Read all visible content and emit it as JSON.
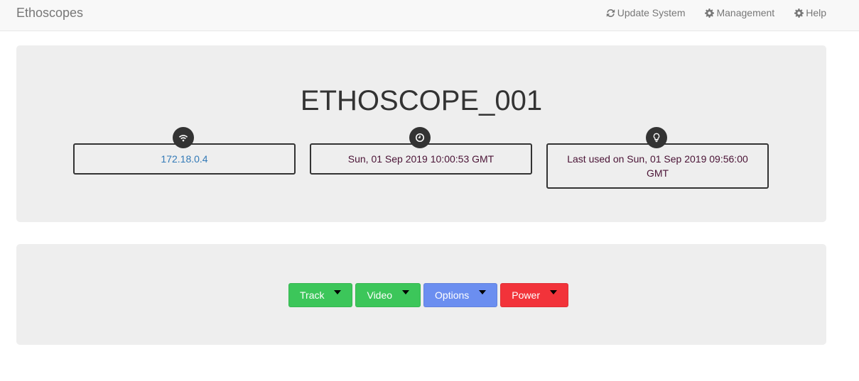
{
  "navbar": {
    "brand": "Ethoscopes",
    "links": [
      {
        "label": "Update System",
        "icon": "refresh-icon"
      },
      {
        "label": "Management",
        "icon": "gear-icon"
      },
      {
        "label": "Help",
        "icon": "gear-icon"
      }
    ]
  },
  "device": {
    "name": "ETHOSCOPE_001",
    "ip": "172.18.0.4",
    "time": "Sun, 01 Sep 2019 10:00:53 GMT",
    "last_used": "Last used on Sun, 01 Sep 2019 09:56:00 GMT"
  },
  "actions": [
    {
      "label": "Track",
      "color": "#3cc65a"
    },
    {
      "label": "Video",
      "color": "#3cc65a"
    },
    {
      "label": "Options",
      "color": "#6b8ef0"
    },
    {
      "label": "Power",
      "color": "#f2333a"
    }
  ],
  "colors": {
    "panel_bg": "#eeeeee",
    "ip_link": "#337ab7",
    "time_text": "#4a1335"
  }
}
